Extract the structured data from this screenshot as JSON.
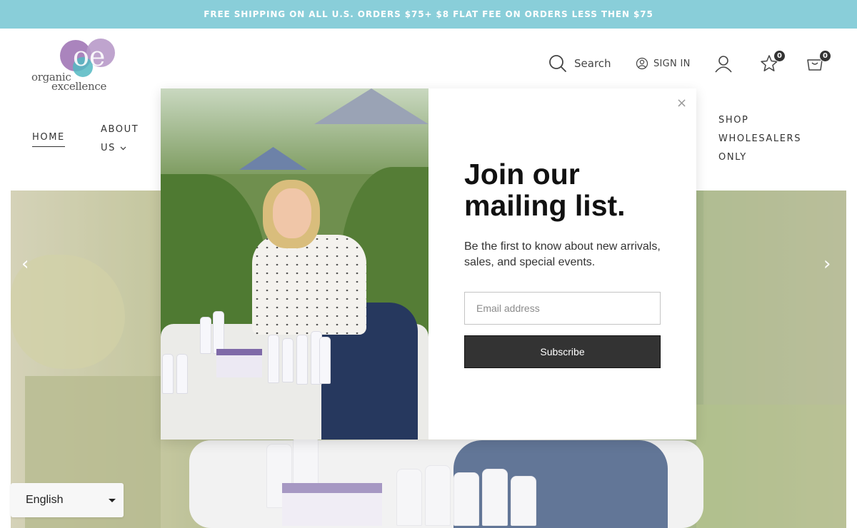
{
  "announcement": "FREE SHIPPING ON ALL U.S. ORDERS $75+ $8 FLAT FEE ON ORDERS LESS THEN $75",
  "brand": {
    "line1": "organic",
    "line2": "excellence"
  },
  "header": {
    "search_label": "Search",
    "signin_label": "SIGN IN",
    "wishlist_count": "0",
    "cart_count": "0"
  },
  "nav": {
    "home": "HOME",
    "about_line1": "ABOUT",
    "about_line2": "US",
    "shop_line1": "SHOP",
    "shop_line2": "WHOLESALERS",
    "shop_line3": "ONLY"
  },
  "hero": {
    "prev": "‹",
    "next": "›"
  },
  "language": {
    "selected": "English"
  },
  "modal": {
    "close": "×",
    "title_line1": "Join our",
    "title_line2": "mailing list.",
    "description": "Be the first to know about new arrivals, sales, and special events.",
    "email_placeholder": "Email address",
    "subscribe_label": "Subscribe"
  },
  "colors": {
    "announcement_bg": "#89ced9",
    "button_bg": "#333333",
    "logo_purple": "#9b6fb1",
    "logo_teal": "#54b9c2"
  },
  "icons": [
    "search-icon",
    "user-circle-icon",
    "account-icon",
    "star-icon",
    "cart-icon",
    "close-icon",
    "chevron-down-icon",
    "chevron-left-icon",
    "chevron-right-icon"
  ]
}
